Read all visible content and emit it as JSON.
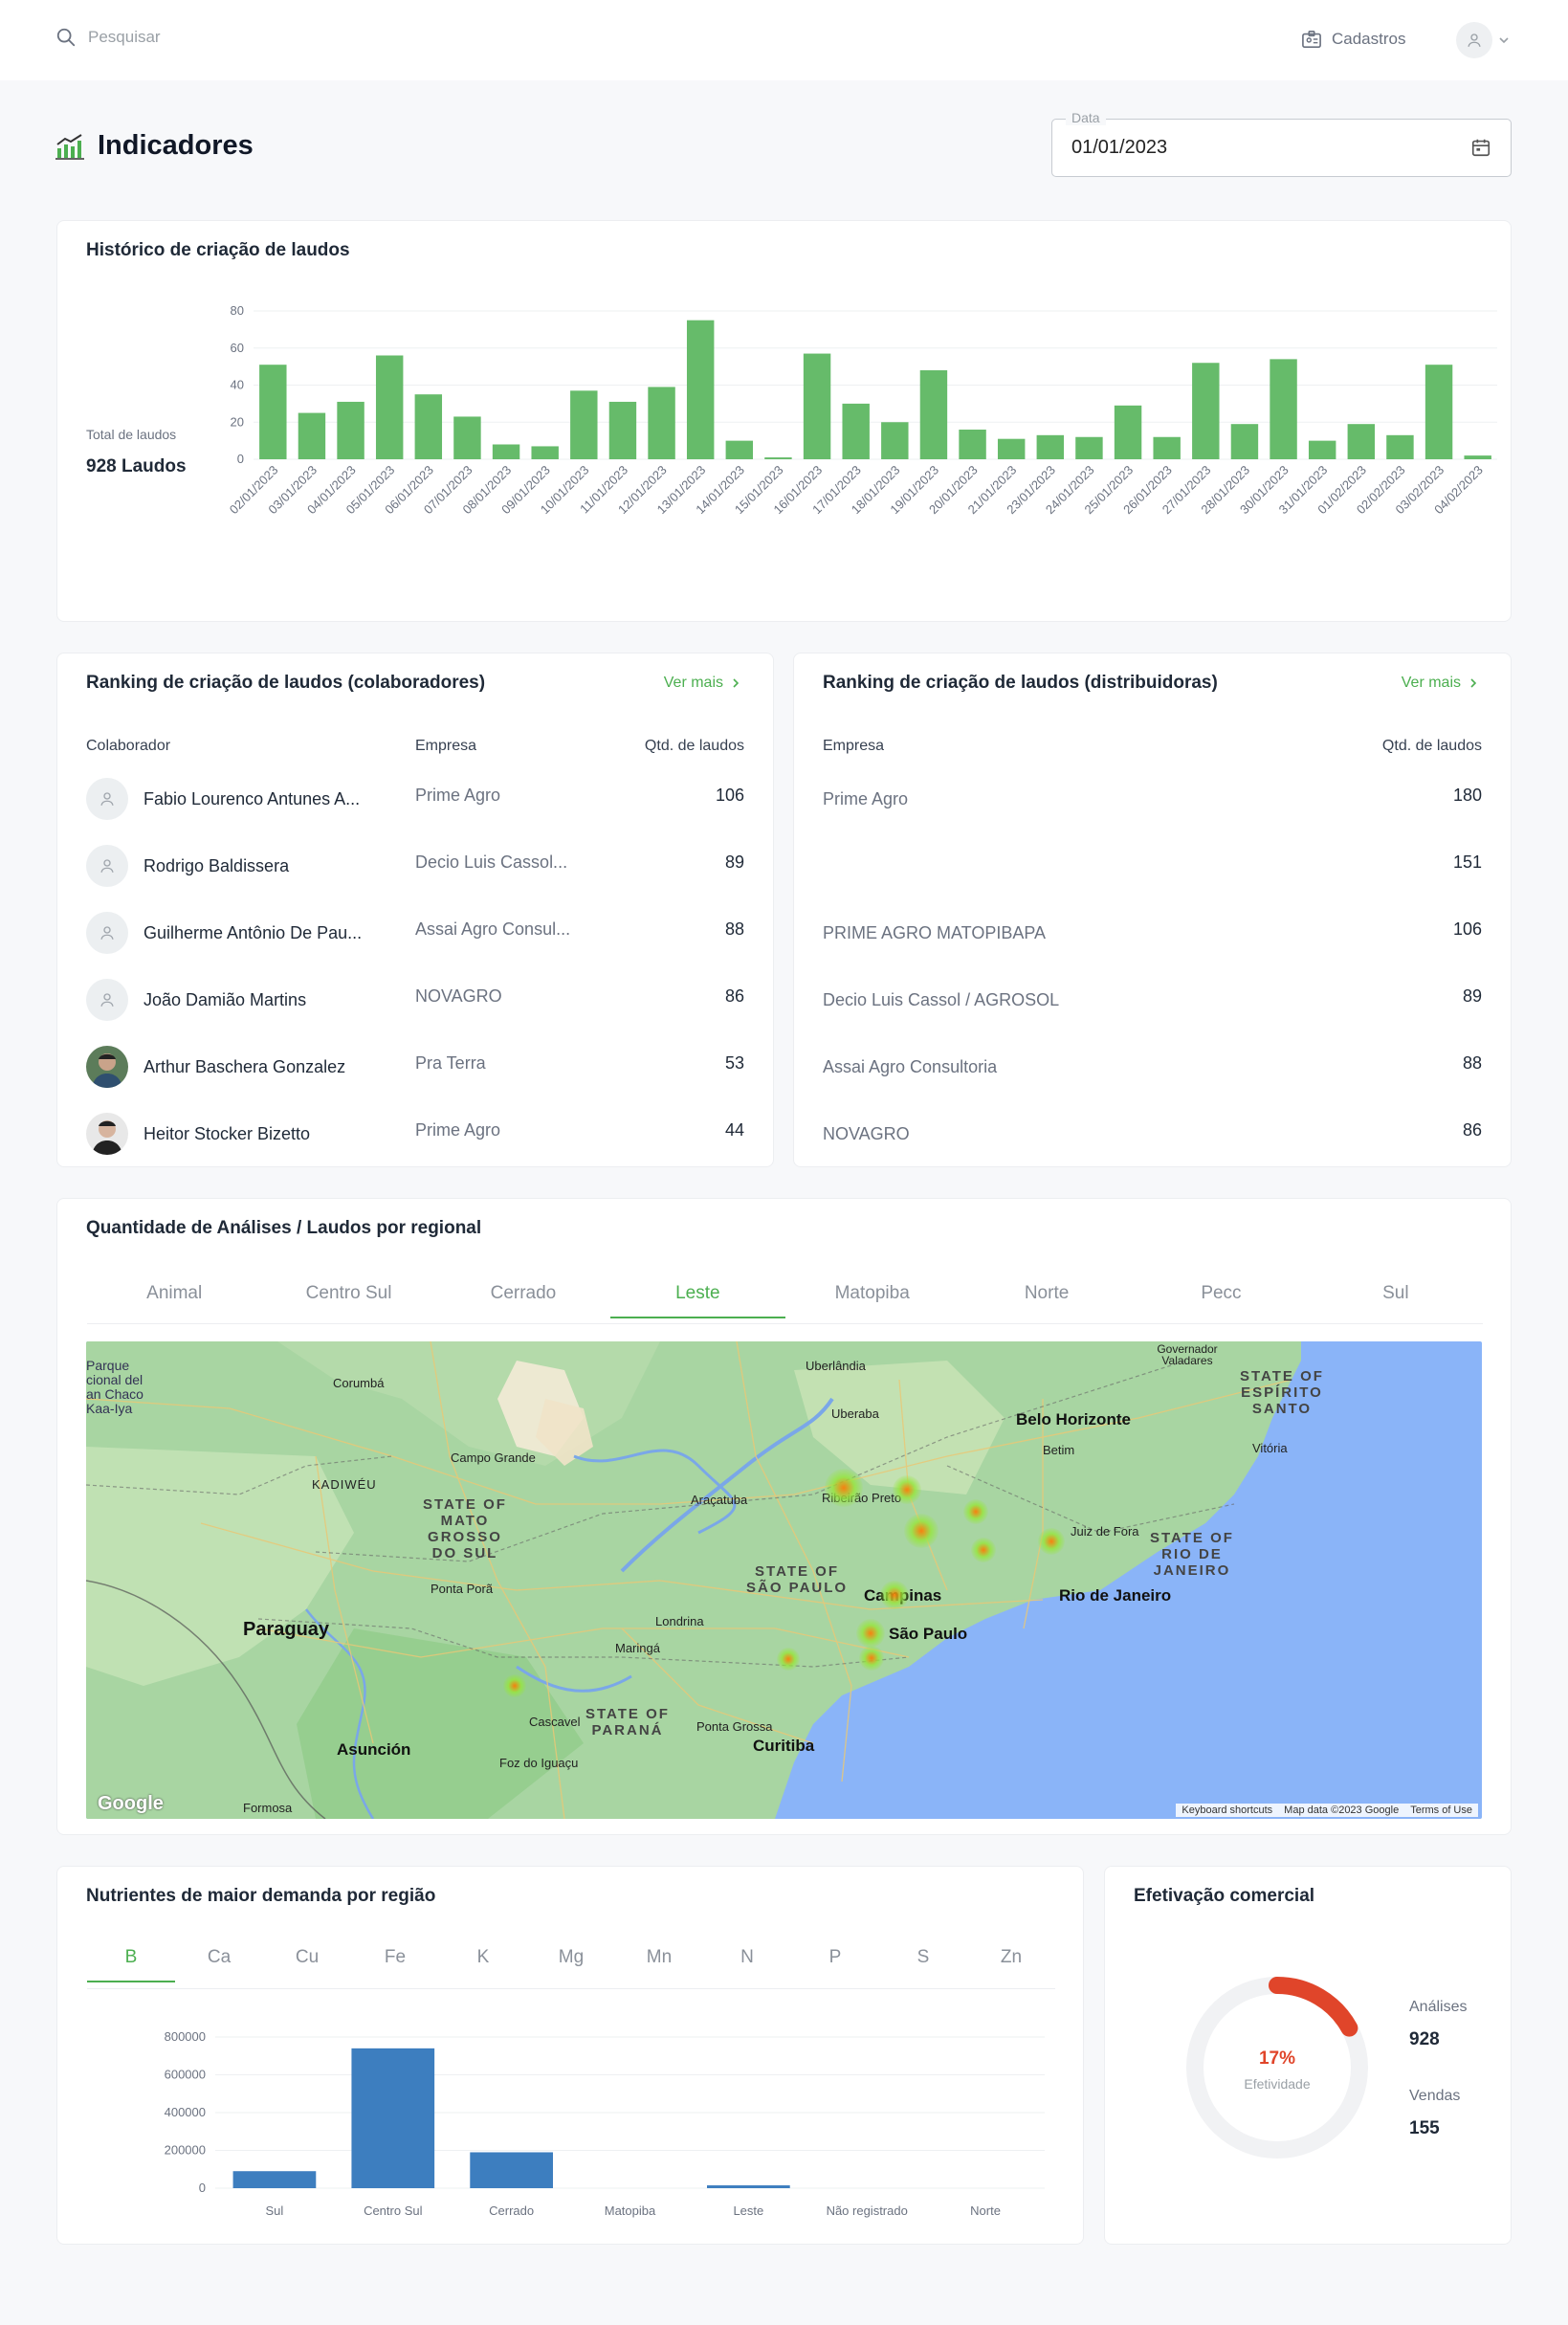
{
  "header": {
    "search_placeholder": "Pesquisar",
    "cadastros_label": "Cadastros"
  },
  "page": {
    "title": "Indicadores",
    "date_label": "Data",
    "date_value": "01/01/2023"
  },
  "historico": {
    "title": "Histórico de criação de laudos",
    "total_label": "Total de laudos",
    "total_value": "928 Laudos"
  },
  "chart_data": [
    {
      "type": "bar",
      "title": "Histórico de criação de laudos",
      "categories": [
        "02/01/2023",
        "03/01/2023",
        "04/01/2023",
        "05/01/2023",
        "06/01/2023",
        "07/01/2023",
        "08/01/2023",
        "09/01/2023",
        "10/01/2023",
        "11/01/2023",
        "12/01/2023",
        "13/01/2023",
        "14/01/2023",
        "15/01/2023",
        "16/01/2023",
        "17/01/2023",
        "18/01/2023",
        "19/01/2023",
        "20/01/2023",
        "21/01/2023",
        "23/01/2023",
        "24/01/2023",
        "25/01/2023",
        "26/01/2023",
        "27/01/2023",
        "28/01/2023",
        "30/01/2023",
        "31/01/2023",
        "01/02/2023",
        "02/02/2023",
        "03/02/2023",
        "04/02/2023"
      ],
      "values": [
        51,
        25,
        31,
        56,
        35,
        23,
        8,
        7,
        37,
        31,
        39,
        75,
        10,
        1,
        57,
        30,
        20,
        48,
        16,
        11,
        13,
        12,
        29,
        12,
        52,
        19,
        54,
        10,
        19,
        13,
        51,
        2
      ],
      "yticks": [
        "0",
        "20",
        "40",
        "60",
        "80"
      ],
      "ylim": [
        0,
        80
      ],
      "color": "#66bb6a",
      "grid": true
    },
    {
      "type": "bar",
      "title": "Nutrientes de maior demanda por região",
      "categories": [
        "Sul",
        "Centro Sul",
        "Cerrado",
        "Matopiba",
        "Leste",
        "Não registrado",
        "Norte"
      ],
      "values": [
        90000,
        740000,
        190000,
        0,
        15000,
        0,
        0
      ],
      "yticks": [
        "0",
        "200000",
        "400000",
        "600000",
        "800000"
      ],
      "ylim": [
        0,
        800000
      ],
      "color": "#3d7ebf",
      "grid": true
    }
  ],
  "rank_colab": {
    "title": "Ranking de criação de laudos (colaboradores)",
    "ver_mais": "Ver mais",
    "headers": [
      "Colaborador",
      "Empresa",
      "Qtd. de laudos"
    ],
    "rows": [
      {
        "name": "Fabio Lourenco Antunes A...",
        "empresa": "Prime Agro",
        "qtd": "106"
      },
      {
        "name": "Rodrigo Baldissera",
        "empresa": "Decio Luis Cassol...",
        "qtd": "89"
      },
      {
        "name": "Guilherme Antônio De Pau...",
        "empresa": "Assai Agro Consul...",
        "qtd": "88"
      },
      {
        "name": "João Damião Martins",
        "empresa": "NOVAGRO",
        "qtd": "86"
      },
      {
        "name": "Arthur Baschera Gonzalez",
        "empresa": "Pra Terra",
        "qtd": "53"
      },
      {
        "name": "Heitor Stocker Bizetto",
        "empresa": "Prime Agro",
        "qtd": "44"
      }
    ]
  },
  "rank_dist": {
    "title": "Ranking de criação de laudos (distribuidoras)",
    "ver_mais": "Ver mais",
    "headers": [
      "Empresa",
      "Qtd. de laudos"
    ],
    "rows": [
      {
        "empresa": "Prime Agro",
        "qtd": "180"
      },
      {
        "empresa": "",
        "qtd": "151"
      },
      {
        "empresa": "PRIME AGRO MATOPIBAPA",
        "qtd": "106"
      },
      {
        "empresa": "Decio Luis Cassol / AGROSOL",
        "qtd": "89"
      },
      {
        "empresa": "Assai Agro Consultoria",
        "qtd": "88"
      },
      {
        "empresa": "NOVAGRO",
        "qtd": "86"
      }
    ]
  },
  "regional": {
    "title": "Quantidade de Análises / Laudos por regional",
    "tabs": [
      "Animal",
      "Centro Sul",
      "Cerrado",
      "Leste",
      "Matopiba",
      "Norte",
      "Pecc",
      "Sul"
    ],
    "active_tab": "Leste",
    "map": {
      "labels": {
        "corumba": "Corumbá",
        "uberlandia": "Uberlândia",
        "uberaba": "Uberaba",
        "gov_valadares": "Governador Valadares",
        "belo_horizonte": "Belo Horizonte",
        "betim": "Betim",
        "campo_grande": "Campo Grande",
        "kadiweu": "KADIWÉU",
        "araçatuba": "Araçatuba",
        "ribeirao_preto": "Ribeirão Preto",
        "vitoria": "Vitória",
        "juiz_de_fora": "Juiz de Fora",
        "ponta_pora": "Ponta Porã",
        "campinas": "Campinas",
        "sao_paulo": "São Paulo",
        "rio": "Rio de Janeiro",
        "londrina": "Londrina",
        "maringa": "Maringá",
        "cascavel": "Cascavel",
        "ponta_grossa": "Ponta Grossa",
        "curitiba": "Curitiba",
        "asuncion": "Asunción",
        "foz": "Foz do Iguaçu",
        "formosa": "Formosa",
        "paraguay": "Paraguay",
        "chaco": "Parque\ncional del\nan Chaco\nKaa-Iya"
      },
      "states": {
        "ms": "STATE OF\nMATO\nGROSSO\nDO SUL",
        "sp": "STATE OF\nSÃO PAULO",
        "pr": "STATE OF\nPARANÁ",
        "rj": "STATE OF\nRIO DE\nJANEIRO",
        "es": "STATE OF\nESPÍRITO\nSANTO"
      },
      "footer": [
        "Keyboard shortcuts",
        "Map data ©2023 Google",
        "Terms of Use"
      ],
      "logo": "Google"
    }
  },
  "nutrientes": {
    "title": "Nutrientes de maior demanda por região",
    "tabs": [
      "B",
      "Ca",
      "Cu",
      "Fe",
      "K",
      "Mg",
      "Mn",
      "N",
      "P",
      "S",
      "Zn"
    ],
    "active_tab": "B"
  },
  "efetivacao": {
    "title": "Efetivação comercial",
    "percent": "17%",
    "percent_value": 0.17,
    "percent_label": "Efetividade",
    "analises_label": "Análises",
    "analises_value": "928",
    "vendas_label": "Vendas",
    "vendas_value": "155",
    "accent": "#e0452a"
  }
}
